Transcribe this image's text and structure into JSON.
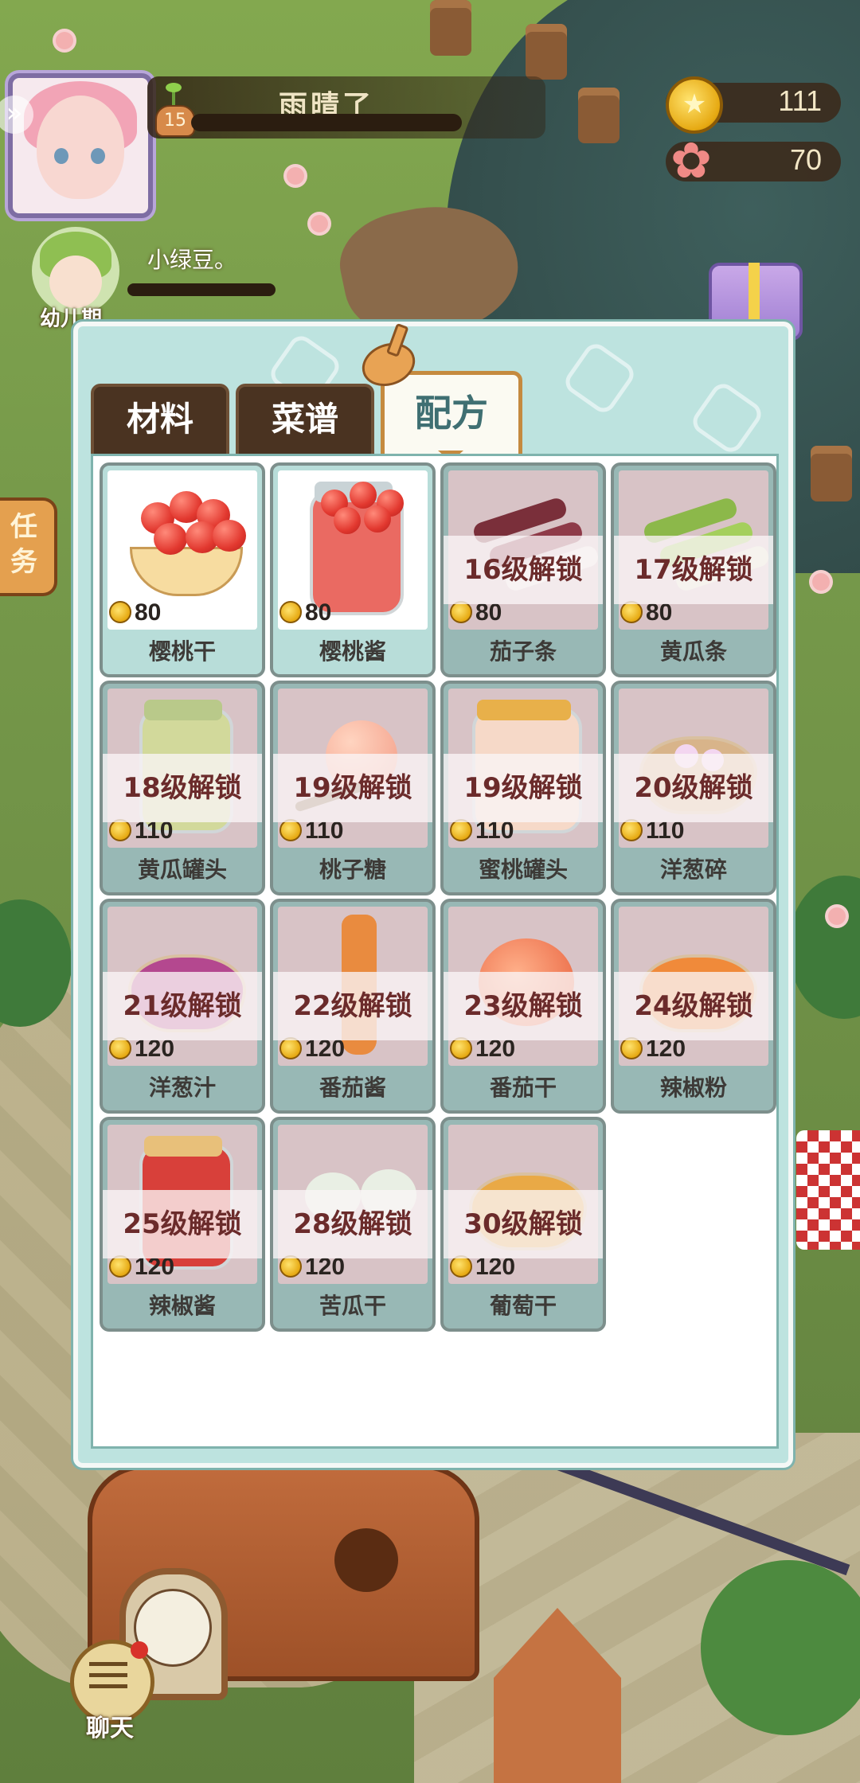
{
  "hud": {
    "title": "雨晴了",
    "level": "15",
    "coins": "111",
    "flowers": "70",
    "coin_glyph": "★",
    "flower_glyph": "✿",
    "pet_name": "小绿豆。",
    "pet_stage": "幼儿期",
    "task_label": "任务",
    "chat_label": "聊天",
    "expand_glyph": "»"
  },
  "tabs": [
    {
      "label": "材料",
      "active": false
    },
    {
      "label": "菜谱",
      "active": false
    },
    {
      "label": "配方",
      "active": true
    }
  ],
  "items": [
    {
      "name": "樱桃干",
      "price": "80",
      "lock": ""
    },
    {
      "name": "樱桃酱",
      "price": "80",
      "lock": ""
    },
    {
      "name": "茄子条",
      "price": "80",
      "lock": "16级解锁"
    },
    {
      "name": "黄瓜条",
      "price": "80",
      "lock": "17级解锁"
    },
    {
      "name": "黄瓜罐头",
      "price": "110",
      "lock": "18级解锁"
    },
    {
      "name": "桃子糖",
      "price": "110",
      "lock": "19级解锁"
    },
    {
      "name": "蜜桃罐头",
      "price": "110",
      "lock": "19级解锁"
    },
    {
      "name": "洋葱碎",
      "price": "110",
      "lock": "20级解锁"
    },
    {
      "name": "洋葱汁",
      "price": "120",
      "lock": "21级解锁"
    },
    {
      "name": "番茄酱",
      "price": "120",
      "lock": "22级解锁"
    },
    {
      "name": "番茄干",
      "price": "120",
      "lock": "23级解锁"
    },
    {
      "name": "辣椒粉",
      "price": "120",
      "lock": "24级解锁"
    },
    {
      "name": "辣椒酱",
      "price": "120",
      "lock": "25级解锁"
    },
    {
      "name": "苦瓜干",
      "price": "120",
      "lock": "28级解锁"
    },
    {
      "name": "葡萄干",
      "price": "120",
      "lock": "30级解锁"
    }
  ]
}
